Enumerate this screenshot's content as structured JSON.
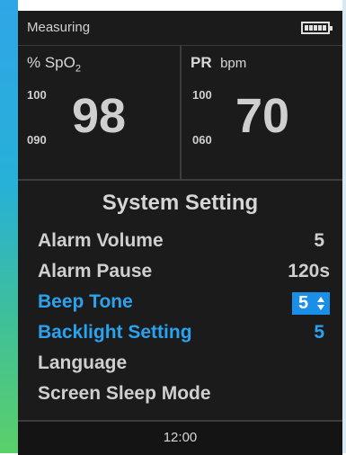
{
  "status": {
    "text": "Measuring",
    "battery_icon": "battery-full-icon"
  },
  "spo2": {
    "label": "% SpO",
    "label_sub": "2",
    "high_limit": "100",
    "low_limit": "090",
    "value": "98"
  },
  "pr": {
    "label": "PR",
    "unit": "bpm",
    "high_limit": "100",
    "low_limit": "060",
    "value": "70"
  },
  "menu": {
    "title": "System Setting",
    "items": [
      {
        "label": "Alarm Volume",
        "value": "5"
      },
      {
        "label": "Alarm Pause",
        "value": "120s"
      },
      {
        "label": "Beep Tone",
        "value": "5"
      },
      {
        "label": "Backlight Setting",
        "value": "5"
      },
      {
        "label": "Language",
        "value": ""
      },
      {
        "label": "Screen Sleep Mode",
        "value": ""
      }
    ]
  },
  "footer": {
    "clock": "12:00"
  },
  "colors": {
    "highlight": "#2aa3ee",
    "selection": "#1a8fe8",
    "screen_bg": "#1b1b1b"
  }
}
